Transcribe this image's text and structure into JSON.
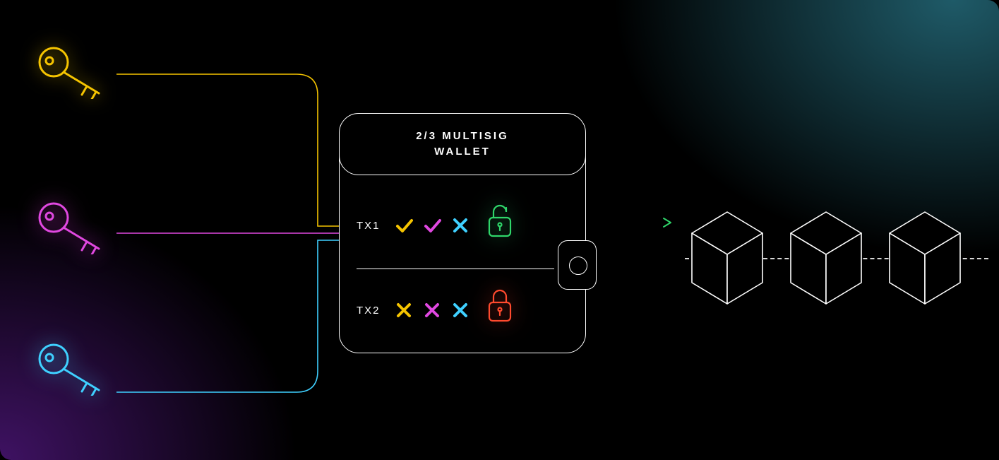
{
  "wallet": {
    "title_line1": "2/3  MULTISIG",
    "title_line2": "WALLET"
  },
  "keys": [
    {
      "color": "#f5c400",
      "name": "key-1-yellow"
    },
    {
      "color": "#e048e0",
      "name": "key-2-magenta"
    },
    {
      "color": "#3fd0ff",
      "name": "key-3-cyan"
    }
  ],
  "transactions": [
    {
      "label": "TX1",
      "signatures": [
        {
          "status": "approved",
          "color": "#f5c400"
        },
        {
          "status": "approved",
          "color": "#e048e0"
        },
        {
          "status": "rejected",
          "color": "#3fd0ff"
        }
      ],
      "lock": {
        "state": "unlocked",
        "color": "#2fd66a"
      }
    },
    {
      "label": "TX2",
      "signatures": [
        {
          "status": "rejected",
          "color": "#f5c400"
        },
        {
          "status": "rejected",
          "color": "#e048e0"
        },
        {
          "status": "rejected",
          "color": "#3fd0ff"
        }
      ],
      "lock": {
        "state": "locked",
        "color": "#ff4a2e"
      }
    }
  ],
  "output": {
    "arrow_gradient": [
      "#f5c400",
      "#2fd66a"
    ],
    "block_count": 3
  }
}
